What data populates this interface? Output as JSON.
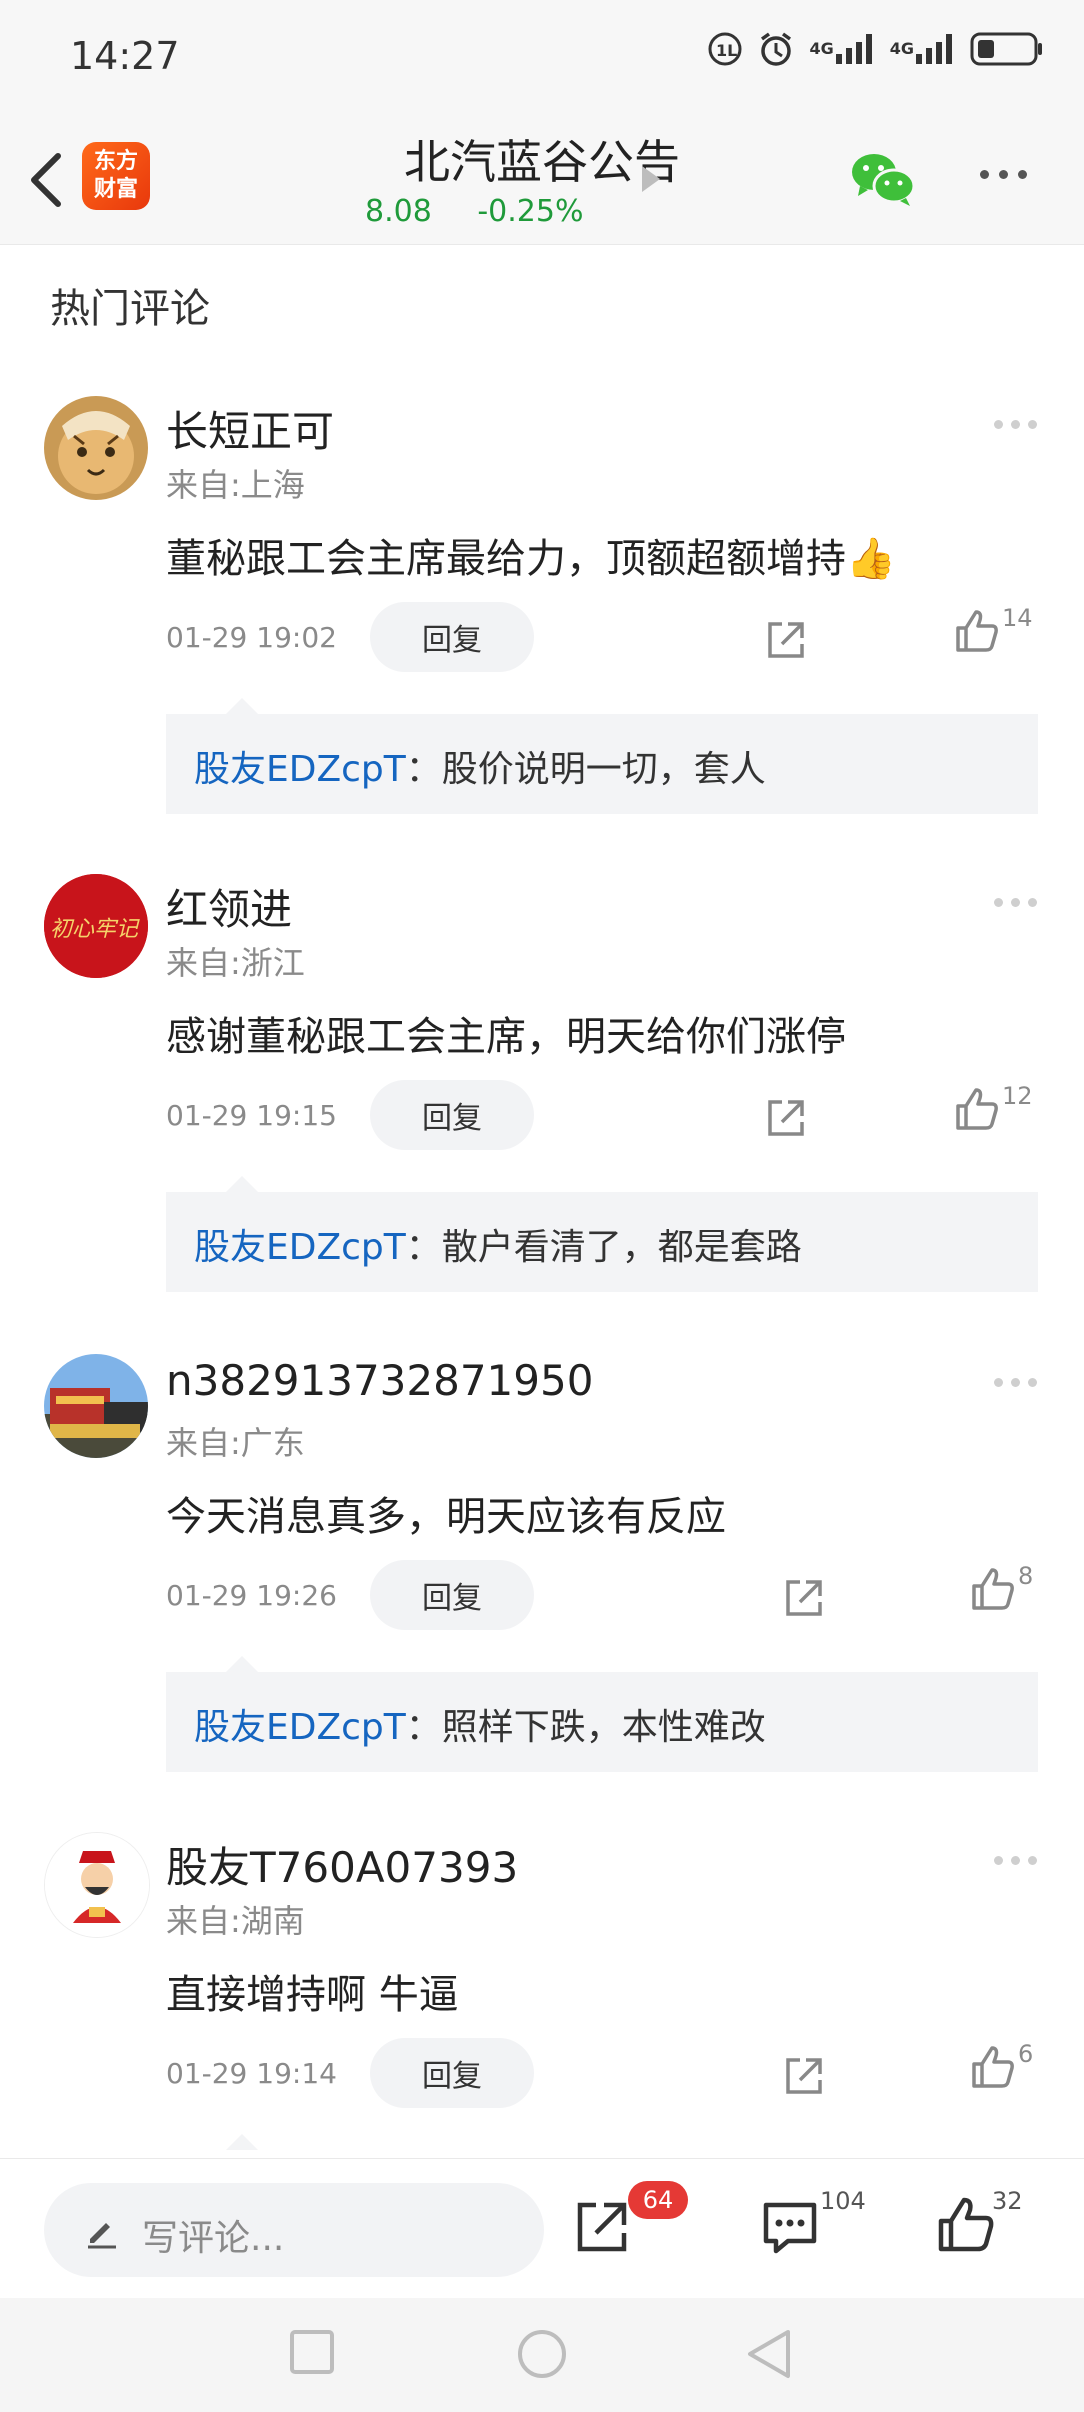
{
  "status_bar": {
    "time": "14:27",
    "signal_labels": [
      "4G",
      "4G"
    ]
  },
  "header": {
    "app_logo_text": [
      "东方",
      "财富"
    ],
    "title": "北汽蓝谷公告",
    "price": "8.08",
    "change": "-0.25%",
    "price_color": "#1f9a3a",
    "wechat_color": "#3fbf3a"
  },
  "section_title": "热门评论",
  "comments": [
    {
      "user": "长短正可",
      "location": "来自:上海",
      "content": "董秘跟工会主席最给力，顶额超额增持👍",
      "date": "01-29 19:02",
      "reply_label": "回复",
      "likes": "14",
      "quote_user": "股友EDZcpT",
      "quote_text": "：股价说明一切，套人",
      "avatar": "tiger-avatar"
    },
    {
      "user": "红领进",
      "location": "来自:浙江",
      "content": "感谢董秘跟工会主席，明天给你们涨停",
      "date": "01-29 19:15",
      "reply_label": "回复",
      "likes": "12",
      "quote_user": "股友EDZcpT",
      "quote_text": "：散户看清了，都是套路",
      "avatar_text": "初心牢记"
    },
    {
      "user": "n382913732871950",
      "location": "来自:广东",
      "content": "今天消息真多，明天应该有反应",
      "date": "01-29 19:26",
      "reply_label": "回复",
      "likes": "8",
      "quote_user": "股友EDZcpT",
      "quote_text": "：照样下跌，本性难改",
      "avatar": "building-photo-avatar"
    },
    {
      "user": "股友T760A07393",
      "location": "来自:湖南",
      "content": "直接增持啊 牛逼",
      "date": "01-29 19:14",
      "reply_label": "回复",
      "likes": "6",
      "avatar": "fortune-god-avatar"
    }
  ],
  "bottom_bar": {
    "write_placeholder": "写评论...",
    "share_badge": "64",
    "comment_count": "104",
    "like_count": "32",
    "badge_color": "#e53935"
  },
  "nav_bar": {
    "buttons": [
      "recent-apps",
      "home",
      "back"
    ]
  }
}
